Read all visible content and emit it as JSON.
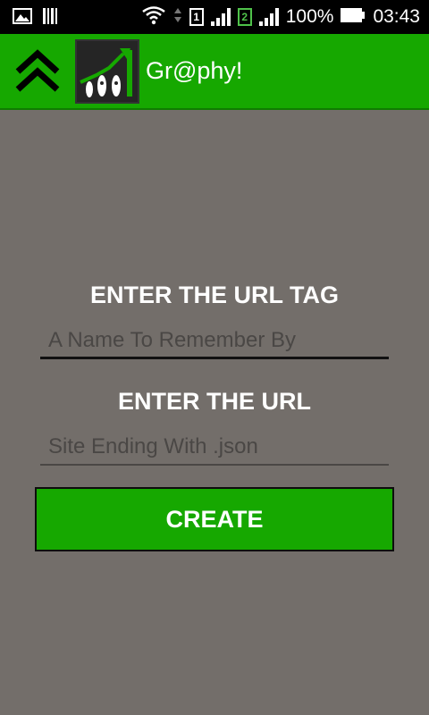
{
  "status_bar": {
    "sim1": "1",
    "sim2": "2",
    "battery": "100%",
    "time": "03:43",
    "icons": [
      "gallery-icon",
      "barcode-icon",
      "wifi-icon",
      "sim1-icon",
      "signal-icon",
      "sim2-icon",
      "signal-icon",
      "battery-icon"
    ]
  },
  "app_bar": {
    "title": "Gr@phy!",
    "up_icon": "double-chevron-up-icon",
    "app_icon": "rockets-chart-app-icon"
  },
  "form": {
    "tag_label": "ENTER THE URL TAG",
    "tag_placeholder": "A Name To Remember By",
    "tag_value": "",
    "url_label": "ENTER THE URL",
    "url_placeholder": "Site Ending With .json",
    "url_value": "",
    "create_label": "CREATE"
  },
  "colors": {
    "accent": "#16a800",
    "background": "#736e6a",
    "status_bar": "#000000",
    "text": "#ffffff"
  }
}
